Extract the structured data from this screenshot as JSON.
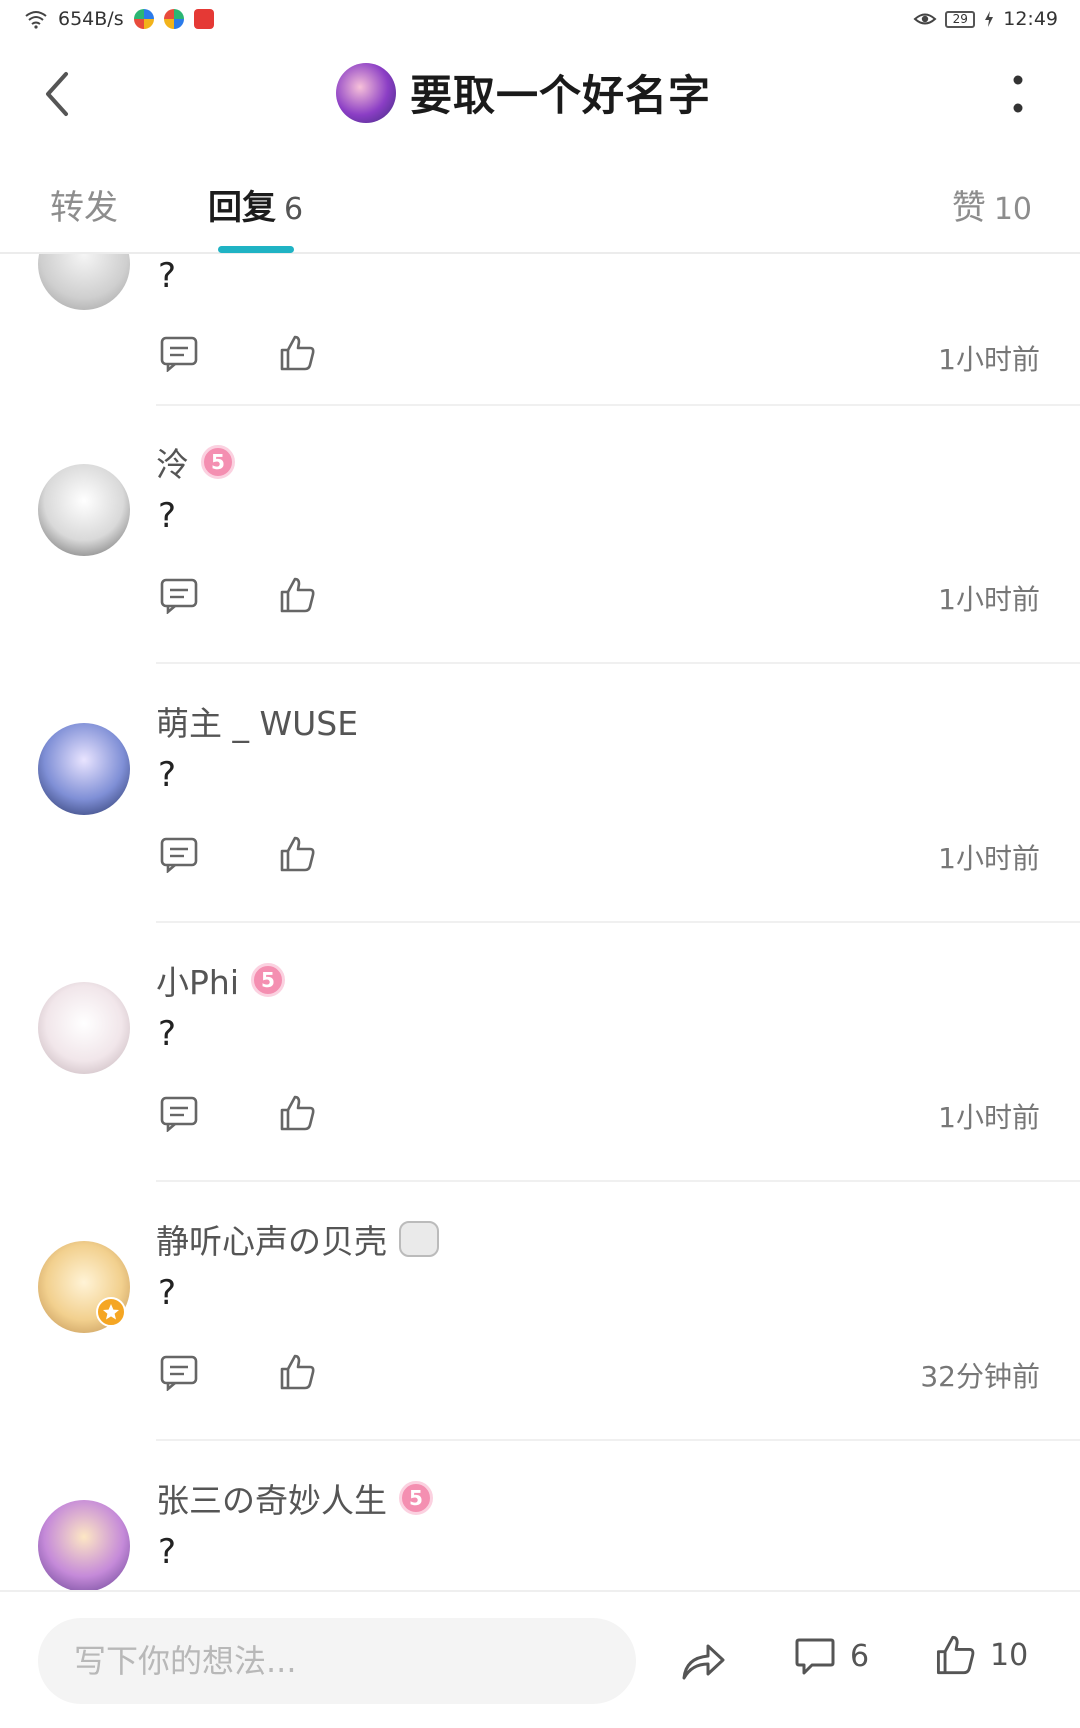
{
  "status_bar": {
    "net_speed": "654B/s",
    "battery": "29",
    "time": "12:49",
    "icons": [
      "wifi-icon",
      "app-notification-icon",
      "app-notification-icon",
      "app-notification-icon",
      "eye-icon",
      "battery-icon",
      "charging-icon"
    ]
  },
  "header": {
    "title": "要取一个好名字",
    "back_icon": "chevron-left-icon",
    "more_icon": "more-vertical-icon"
  },
  "tabs": {
    "forward_label": "转发",
    "reply_label": "回复",
    "reply_count": "6",
    "like_label": "赞",
    "like_count": "10",
    "accent": "#1fb3c4"
  },
  "comments": [
    {
      "username": "",
      "badge": "",
      "content": "?",
      "time": "1小时前"
    },
    {
      "username": "泠",
      "badge": "5",
      "content": "?",
      "time": "1小时前"
    },
    {
      "username": "萌主 _ WUSE",
      "badge": "",
      "content": "?",
      "time": "1小时前"
    },
    {
      "username": "小Phi",
      "badge": "5",
      "content": "?",
      "time": "1小时前"
    },
    {
      "username": "静听心声の贝壳",
      "badge": "sticker",
      "content": "?",
      "time": "32分钟前"
    },
    {
      "username": "张三の奇妙人生",
      "badge": "5",
      "content": "?",
      "time": ""
    }
  ],
  "bottom_bar": {
    "input_placeholder": "写下你的想法...",
    "comment_count": "6",
    "like_count": "10"
  }
}
